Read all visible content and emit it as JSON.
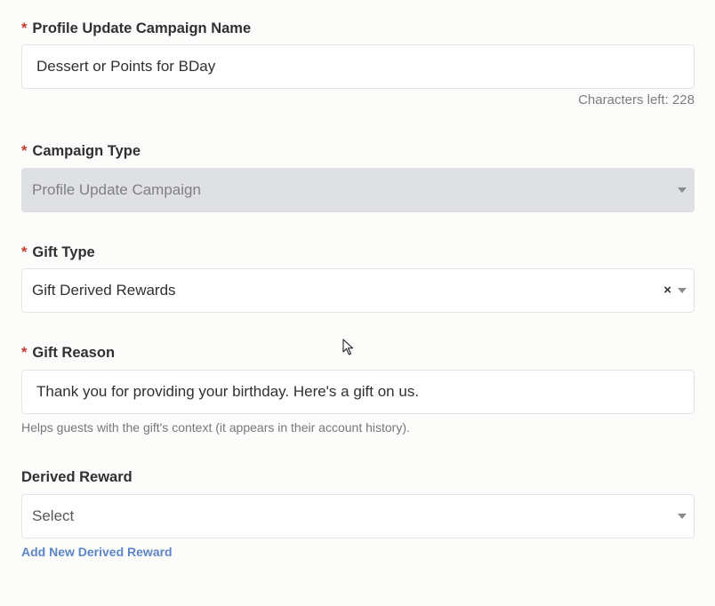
{
  "form": {
    "campaign_name": {
      "required_mark": "*",
      "label": "Profile Update Campaign Name",
      "value": "Dessert or Points for BDay",
      "counter": "Characters left: 228"
    },
    "campaign_type": {
      "required_mark": "*",
      "label": "Campaign Type",
      "value": "Profile Update Campaign"
    },
    "gift_type": {
      "required_mark": "*",
      "label": "Gift Type",
      "value": "Gift Derived Rewards",
      "clear": "×"
    },
    "gift_reason": {
      "required_mark": "*",
      "label": "Gift Reason",
      "value": "Thank you for providing your birthday. Here's a gift on us.",
      "help": "Helps guests with the gift's context (it appears in their account history)."
    },
    "derived_reward": {
      "label": "Derived Reward",
      "placeholder": "Select",
      "add_link": "Add New Derived Reward"
    }
  },
  "colors": {
    "required": "#c53a32",
    "link": "#5b86c5",
    "disabled_bg": "#dfe0e3"
  },
  "icons": {
    "dropdown": "chevron-down-icon",
    "clear": "clear-icon",
    "cursor": "mouse-pointer-icon"
  }
}
